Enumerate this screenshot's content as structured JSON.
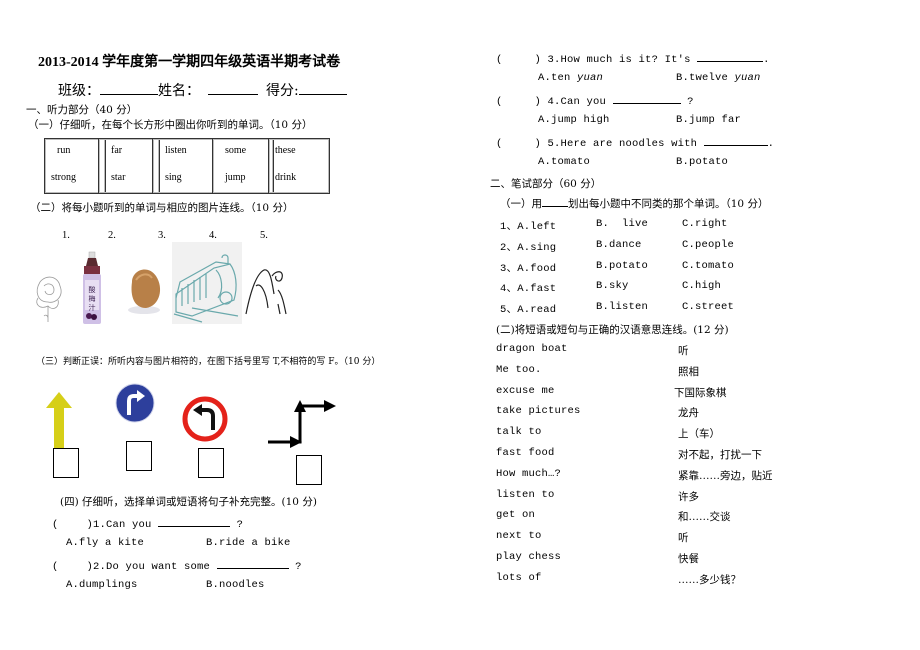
{
  "header": {
    "title": "2013-2014 学年度第一学期四年级英语半期考试卷",
    "class_label": "班级：",
    "name_label": "姓名：",
    "score_label": "得分:"
  },
  "part1": {
    "heading": "一、听力部分（40 分）",
    "s1": {
      "heading": "（一）仔细听，在每个长方形中圈出你听到的单词。（10 分）",
      "boxes": [
        {
          "top": "run",
          "bottom": "strong"
        },
        {
          "top": "far",
          "bottom": "star"
        },
        {
          "top": "listen",
          "bottom": "sing"
        },
        {
          "top": "some",
          "bottom": "jump"
        },
        {
          "top": "these",
          "bottom": "drink"
        }
      ]
    },
    "s2": {
      "heading": "（二）将每小题听到的单词与相应的图片连线。（10 分）",
      "numbers": [
        "1.",
        "2.",
        "3.",
        "4.",
        "5."
      ],
      "pictures": [
        "rose-picture",
        "juice-bottle-picture",
        "potato-picture",
        "train-picture",
        "mountain-picture"
      ],
      "bottle_label": "酸梅汁"
    },
    "s3": {
      "heading": "（三）判断正误：所听内容与图片相符的，在图下括号里写 T,不相符的写 F。（10 分）",
      "signs": [
        "straight-arrow",
        "turn-right-sign",
        "no-left-turn-sign",
        "zigzag-arrow"
      ]
    },
    "s4": {
      "heading": "(四) 仔细听，选择单词或短语将句子补充完整。(10 分)",
      "questions": [
        {
          "paren": "(",
          "close": ")",
          "text": "1.Can you",
          "end": "?",
          "a": "A.fly a kite",
          "b": "B.ride a bike"
        },
        {
          "paren": "(",
          "close": ")",
          "text": "2.Do you want some",
          "end": "?",
          "a": "A.dumplings",
          "b": "B.noodles"
        },
        {
          "paren": "(",
          "close": ")",
          "text": "3.How much is it? It's",
          "end": ".",
          "a": "A.ten ",
          "a_italic": "yuan",
          "b": "B.twelve ",
          "b_italic": "yuan"
        },
        {
          "paren": "(",
          "close": ")",
          "text": "4.Can you",
          "end": "?",
          "a": "A.jump high",
          "b": "B.jump far"
        },
        {
          "paren": "(",
          "close": ")",
          "text": "5.Here are noodles with",
          "end": ".",
          "a": "A.tomato",
          "b": "B.potato"
        }
      ]
    }
  },
  "part2": {
    "heading": "二、笔试部分（60 分）",
    "s1": {
      "heading_pre": "（一）用",
      "heading_post": "划出每小题中不同类的那个单词。（10 分）",
      "rows": [
        {
          "n": "1、A.left",
          "b": "B.  live",
          "c": "C.right"
        },
        {
          "n": "2、A.sing",
          "b": "B.dance",
          "c": "C.people"
        },
        {
          "n": "3、A.food",
          "b": "B.potato",
          "c": "C.tomato"
        },
        {
          "n": "4、A.fast",
          "b": "B.sky",
          "c": "C.high"
        },
        {
          "n": "5、A.read",
          "b": "B.listen",
          "c": "C.street"
        }
      ]
    },
    "s2": {
      "heading": "(二)将短语或短句与正确的汉语意思连线。(12 分)",
      "left": [
        "dragon boat",
        "Me too.",
        "excuse me",
        "take pictures",
        "talk to",
        "fast food",
        "How much…?",
        "listen to",
        "get on",
        "next to",
        "play chess",
        "lots of"
      ],
      "right": [
        "听",
        "照相",
        "下国际象棋",
        "龙舟",
        "上（车）",
        "对不起，打扰一下",
        "紧靠……旁边，贴近",
        "许多",
        "和……交谈",
        "听",
        "快餐",
        "……多少钱？"
      ]
    }
  }
}
